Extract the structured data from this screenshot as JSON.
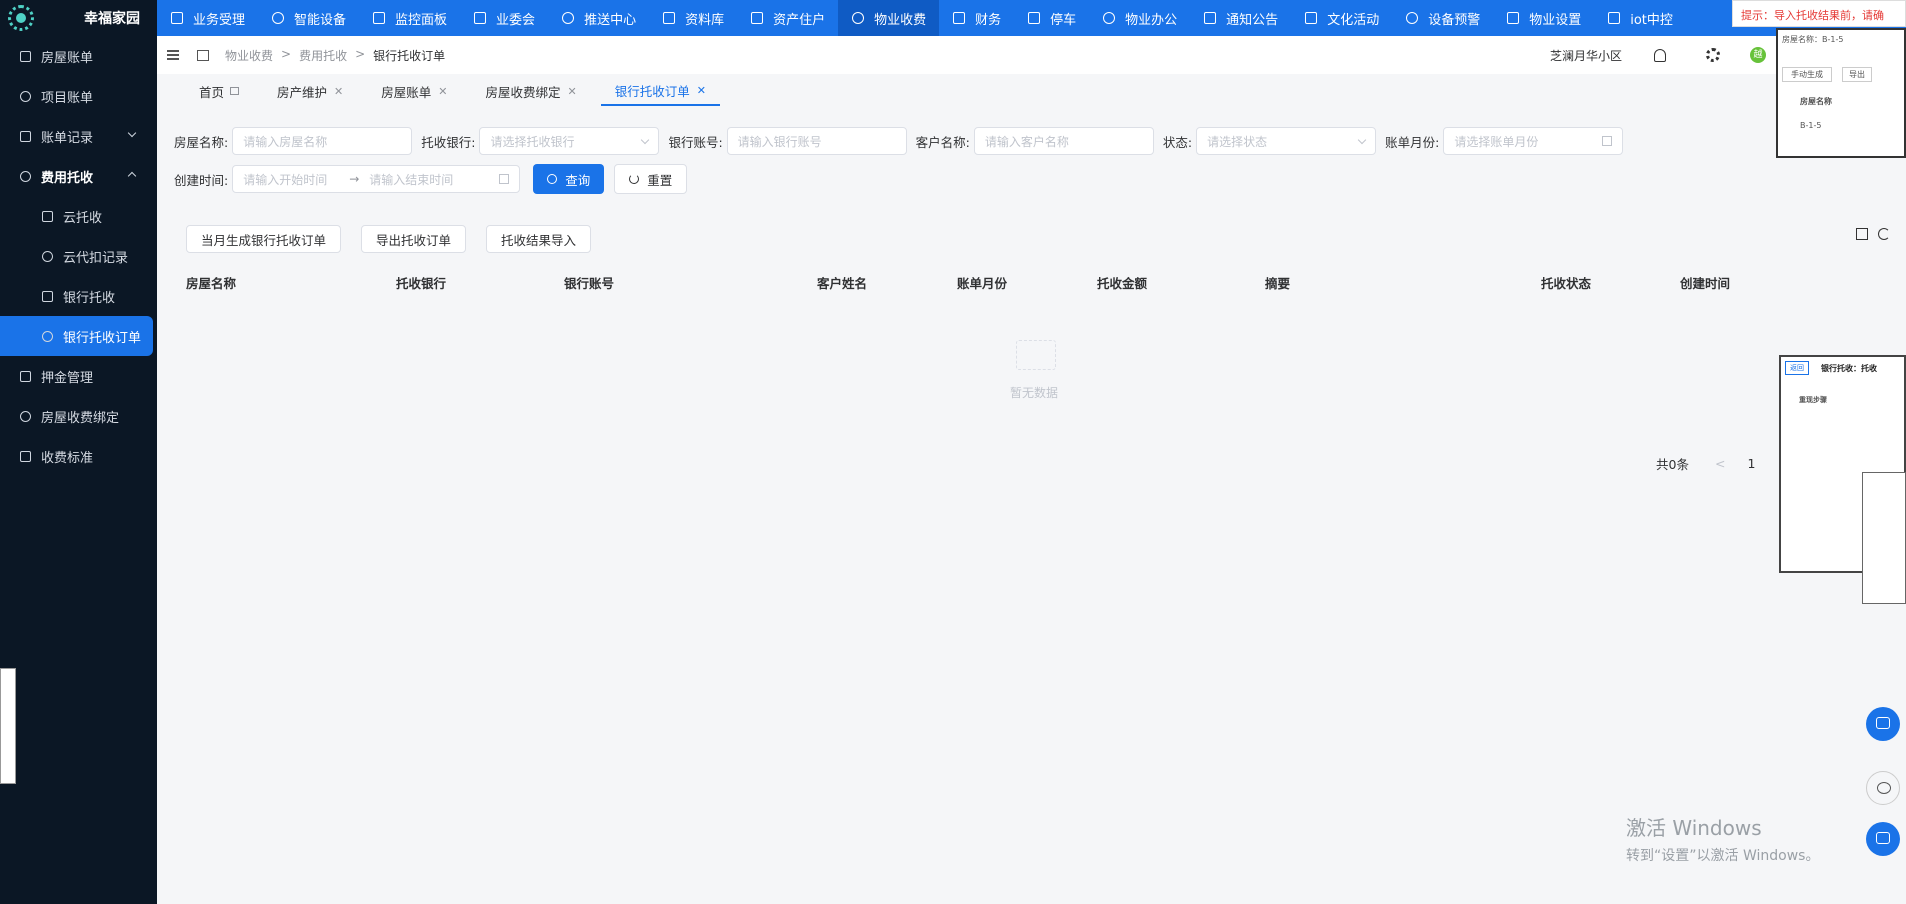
{
  "app": {
    "name": "幸福家园"
  },
  "topnav": [
    {
      "label": "业务受理",
      "icon": "form-icon"
    },
    {
      "label": "智能设备",
      "icon": "device-icon"
    },
    {
      "label": "监控面板",
      "icon": "monitor-icon"
    },
    {
      "label": "业委会",
      "icon": "committee-icon"
    },
    {
      "label": "推送中心",
      "icon": "push-icon"
    },
    {
      "label": "资料库",
      "icon": "document-icon"
    },
    {
      "label": "资产住户",
      "icon": "home-icon"
    },
    {
      "label": "物业收费",
      "icon": "fee-icon",
      "active": true
    },
    {
      "label": "财务",
      "icon": "finance-icon"
    },
    {
      "label": "停车",
      "icon": "car-icon"
    },
    {
      "label": "物业办公",
      "icon": "office-icon"
    },
    {
      "label": "通知公告",
      "icon": "announce-icon"
    },
    {
      "label": "文化活动",
      "icon": "activity-icon"
    },
    {
      "label": "设备预警",
      "icon": "alarm-icon"
    },
    {
      "label": "物业设置",
      "icon": "settings-icon"
    },
    {
      "label": "iot中控",
      "icon": "iot-icon"
    }
  ],
  "hint": "提示：导入托收结果前，请确",
  "sidebar": [
    {
      "label": "房屋账单",
      "type": "item"
    },
    {
      "label": "项目账单",
      "type": "item"
    },
    {
      "label": "账单记录",
      "type": "item",
      "chevron": "down"
    },
    {
      "label": "费用托收",
      "type": "group",
      "chevron": "up"
    },
    {
      "label": "云托收",
      "type": "sub"
    },
    {
      "label": "云代扣记录",
      "type": "sub"
    },
    {
      "label": "银行托收",
      "type": "sub"
    },
    {
      "label": "银行托收订单",
      "type": "sub",
      "active": true
    },
    {
      "label": "押金管理",
      "type": "item"
    },
    {
      "label": "房屋收费绑定",
      "type": "item"
    },
    {
      "label": "收费标准",
      "type": "item"
    }
  ],
  "breadcrumb": [
    "物业收费",
    ">",
    "费用托收",
    ">",
    "银行托收订单"
  ],
  "header": {
    "community": "芝澜月华小区",
    "avatar": "越"
  },
  "tabs": [
    {
      "label": "首页",
      "home": true
    },
    {
      "label": "房产维护",
      "closable": true
    },
    {
      "label": "房屋账单",
      "closable": true
    },
    {
      "label": "房屋收费绑定",
      "closable": true
    },
    {
      "label": "银行托收订单",
      "closable": true,
      "active": true
    }
  ],
  "filter": {
    "house_name": {
      "label": "房屋名称:",
      "placeholder": "请输入房屋名称"
    },
    "bank": {
      "label": "托收银行:",
      "placeholder": "请选择托收银行"
    },
    "account": {
      "label": "银行账号:",
      "placeholder": "请输入银行账号"
    },
    "customer": {
      "label": "客户名称:",
      "placeholder": "请输入客户名称"
    },
    "status": {
      "label": "状态:",
      "placeholder": "请选择状态"
    },
    "month": {
      "label": "账单月份:",
      "placeholder": "请选择账单月份"
    },
    "created": {
      "label": "创建时间:",
      "start": "请输入开始时间",
      "sep": "→",
      "end": "请输入结束时间"
    },
    "query": "查询",
    "reset": "重置"
  },
  "actions": [
    "当月生成银行托收订单",
    "导出托收订单",
    "托收结果导入"
  ],
  "table": {
    "columns": [
      "房屋名称",
      "托收银行",
      "银行账号",
      "客户姓名",
      "账单月份",
      "托收金额",
      "摘要",
      "托收状态",
      "创建时间"
    ],
    "empty": "暂无数据"
  },
  "pager": {
    "total": "共0条",
    "prev": "<",
    "page": "1"
  },
  "overlay": {
    "thumb1_title": "房屋名称：B-1-5",
    "thumb1_btn1": "手动生成",
    "thumb1_btn2": "导出",
    "thumb1_col": "房屋名称",
    "thumb1_row": "B-1-5",
    "thumb2_tag": "返回",
    "thumb2_title": "银行托收：托收",
    "thumb2_heading": "重现步骤"
  },
  "watermark": {
    "line1": "激活 Windows",
    "line2": "转到“设置”以激活 Windows。"
  }
}
